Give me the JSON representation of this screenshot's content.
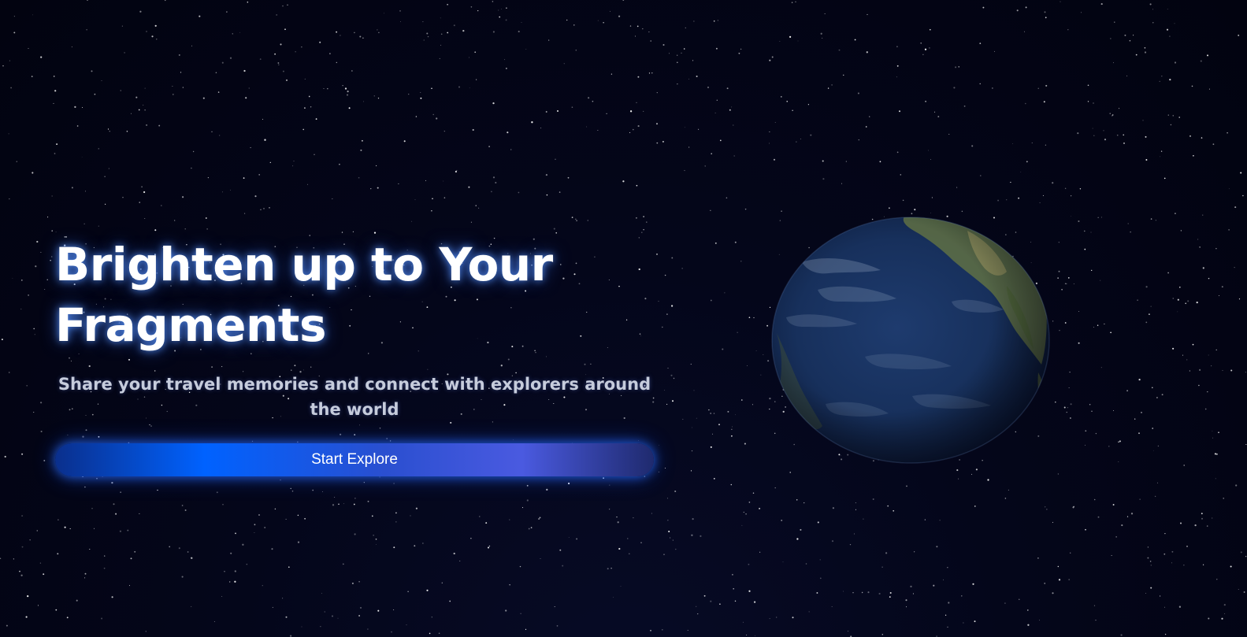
{
  "hero": {
    "title": "Brighten up to Your Fragments",
    "subtitle": "Share your travel memories and connect with explorers around the world",
    "cta_label": "Start Explore"
  },
  "colors": {
    "background": "#03040f",
    "accent_blue": "#0062ff",
    "accent_purple": "#4a5ae0",
    "title_glow": "#5a96ff",
    "ocean": "#1a3565",
    "land": "#7a8a55"
  },
  "icons": {
    "globe": "earth-globe-icon"
  }
}
